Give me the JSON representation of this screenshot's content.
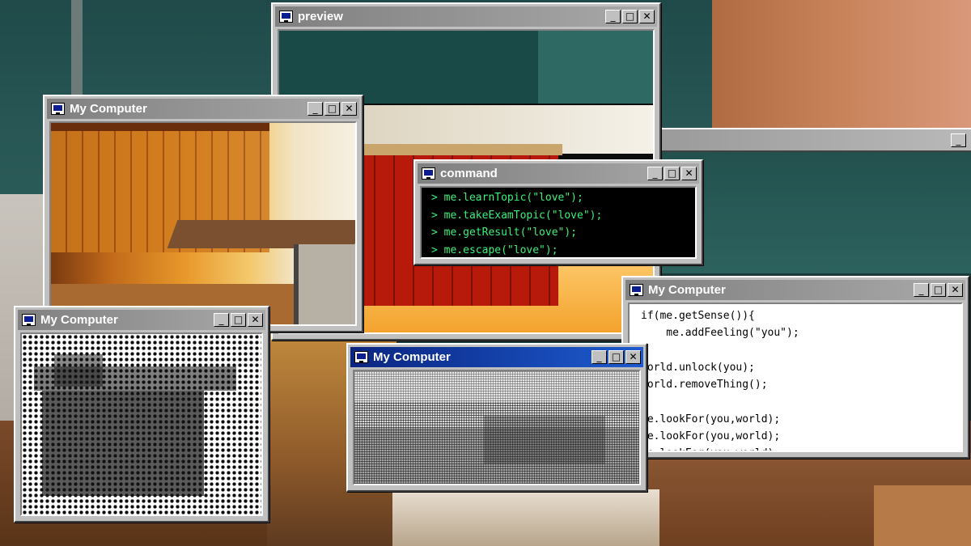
{
  "windows": {
    "preview": {
      "title": "preview"
    },
    "desk_photo": {
      "title": "My Computer"
    },
    "command": {
      "title": "command",
      "lines": [
        "> me.learnTopic(\"love\");",
        "> me.takeExamTopic(\"love\");",
        "> me.getResult(\"love\");",
        "> me.escape(\"love\");"
      ]
    },
    "code": {
      "title": "My Computer",
      "lines": [
        "if(me.getSense()){",
        "    me.addFeeling(\"you\");",
        "}",
        "world.unlock(you);",
        "world.removeThing();",
        "",
        "me.lookFor(you,world);",
        "me.lookFor(you,world);",
        "me.lookFor(you,world);"
      ]
    },
    "halftone": {
      "title": "My Computer"
    },
    "dither": {
      "title": "My Computer"
    }
  },
  "buttons": {
    "minimize": "_",
    "maximize": "□",
    "close": "✕"
  }
}
